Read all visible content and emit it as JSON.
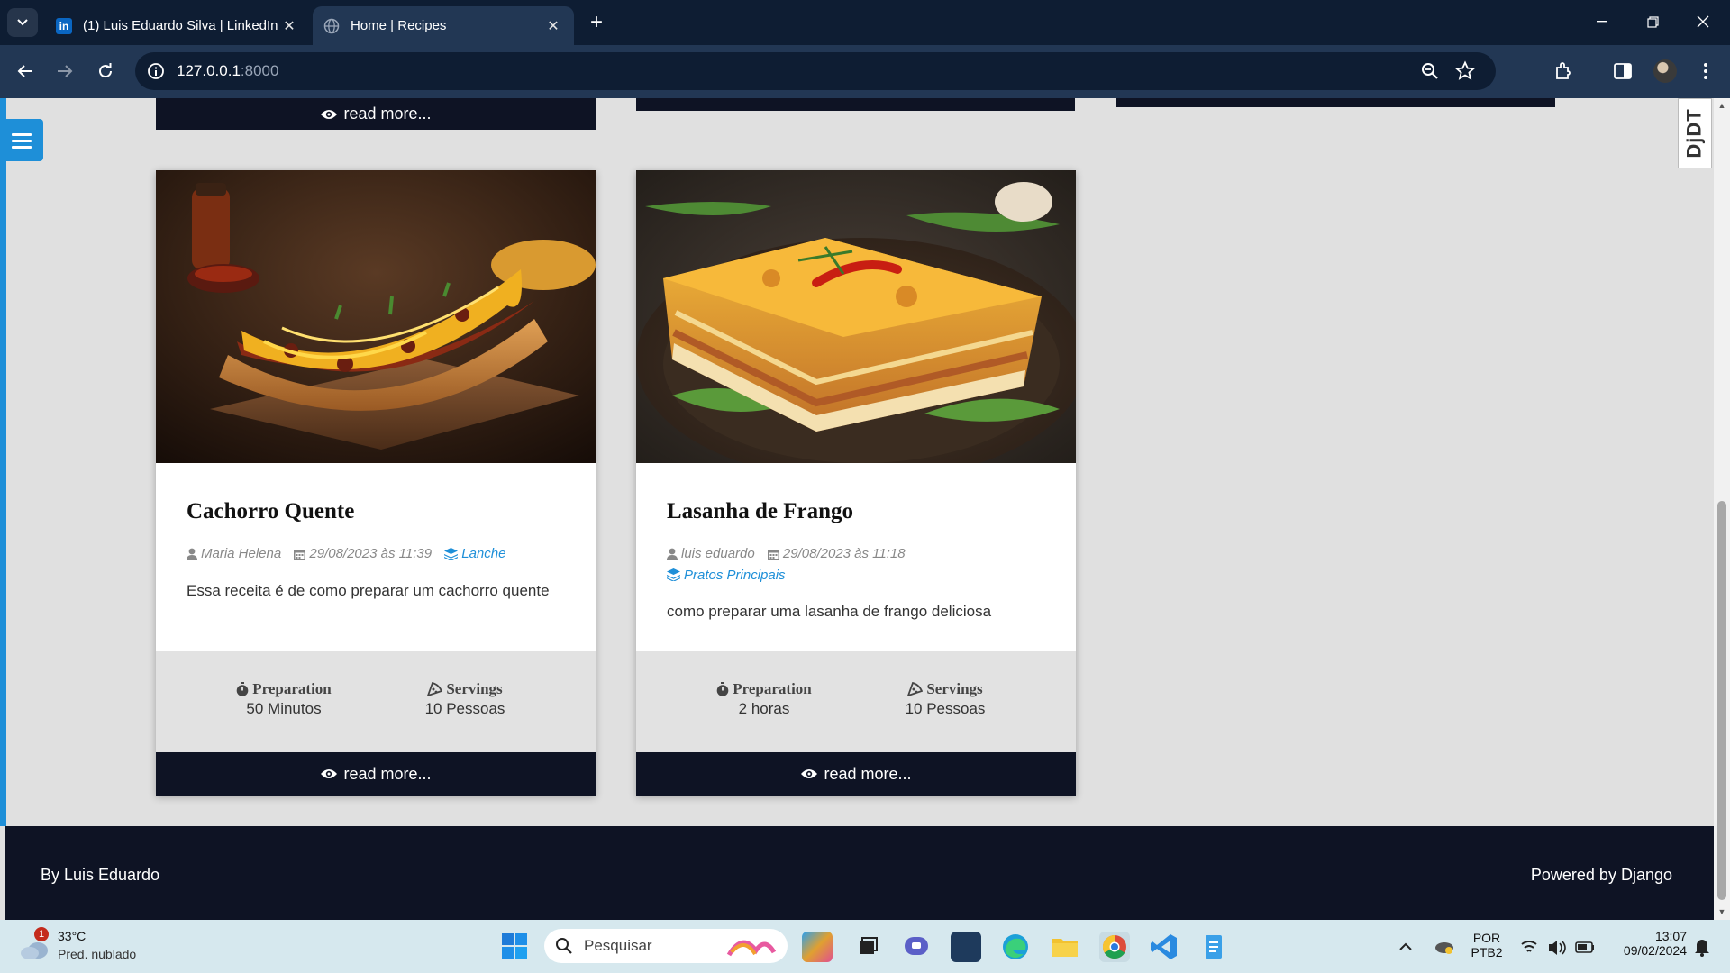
{
  "browser": {
    "tabs": [
      {
        "title": "(1) Luis Eduardo Silva | LinkedIn",
        "favicon": "linkedin-icon",
        "active": false
      },
      {
        "title": "Home | Recipes",
        "favicon": "globe-icon",
        "active": true
      }
    ],
    "url_host": "127.0.0.1",
    "url_port": ":8000"
  },
  "page": {
    "djdt_label": "DjDT",
    "previous_row": {
      "read_more_label": "read more..."
    },
    "recipes": [
      {
        "title": "Cachorro Quente",
        "author": "Maria Helena",
        "date": "29/08/2023 às 11:39",
        "category": "Lanche",
        "description": "Essa receita é de como preparar um cachorro quente",
        "preparation_label": "Preparation",
        "preparation_value": "50 Minutos",
        "servings_label": "Servings",
        "servings_value": "10 Pessoas",
        "read_more_label": "read more..."
      },
      {
        "title": "Lasanha de Frango",
        "author": "luis eduardo",
        "date": "29/08/2023 às 11:18",
        "category": "Pratos Principais",
        "description": "como preparar uma lasanha de frango deliciosa",
        "preparation_label": "Preparation",
        "preparation_value": "2 horas",
        "servings_label": "Servings",
        "servings_value": "10 Pessoas",
        "read_more_label": "read more..."
      }
    ],
    "footer": {
      "left_text": "By Luis Eduardo",
      "right_text": "Powered by Django"
    }
  },
  "taskbar": {
    "weather_temp": "33°C",
    "weather_desc": "Pred. nublado",
    "weather_badge": "1",
    "search_placeholder": "Pesquisar",
    "lang_top": "POR",
    "lang_bottom": "PTB2",
    "time": "13:07",
    "date": "09/02/2024"
  },
  "colors": {
    "accent": "#1e8fd8",
    "dark": "#0e1324",
    "chrome_dark": "#0e1d33",
    "chrome_toolbar": "#223754"
  }
}
